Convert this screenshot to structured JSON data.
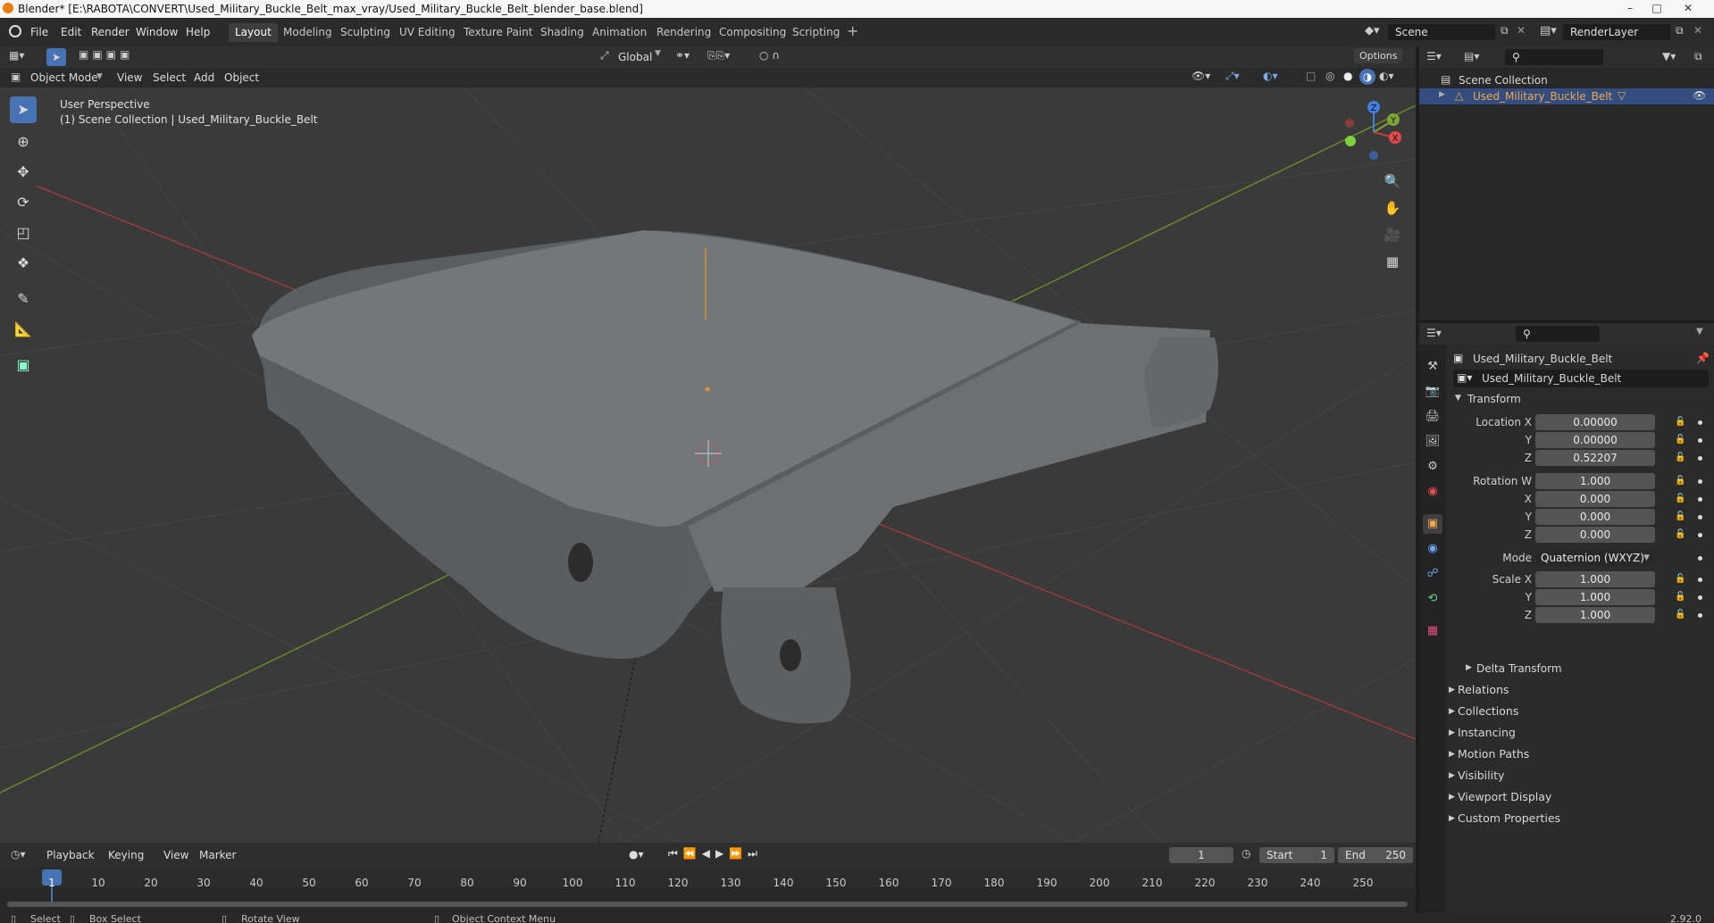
{
  "window": {
    "title": "Blender* [E:\\RABOTA\\CONVERT\\Used_Military_Buckle_Belt_max_vray/Used_Military_Buckle_Belt_blender_base.blend]"
  },
  "menu": [
    "File",
    "Edit",
    "Render",
    "Window",
    "Help"
  ],
  "workspaces": [
    "Layout",
    "Modeling",
    "Sculpting",
    "UV Editing",
    "Texture Paint",
    "Shading",
    "Animation",
    "Rendering",
    "Compositing",
    "Scripting"
  ],
  "active_workspace": "Layout",
  "scene": {
    "name": "Scene",
    "render_layer": "RenderLayer"
  },
  "viewport_header": {
    "mode": "Object Mode",
    "menus": [
      "View",
      "Select",
      "Add",
      "Object"
    ],
    "transform_orientation": "Global",
    "options": "Options"
  },
  "viewport": {
    "perspective": "User Perspective",
    "collection_info": "(1) Scene Collection | Used_Military_Buckle_Belt",
    "gizmo_axes": [
      "Z",
      "Y",
      "X"
    ]
  },
  "outliner": {
    "root": "Scene Collection",
    "items": [
      "Used_Military_Buckle_Belt"
    ]
  },
  "properties": {
    "object_name": "Used_Military_Buckle_Belt",
    "data_name": "Used_Military_Buckle_Belt",
    "transform_title": "Transform",
    "location": {
      "label_x": "Location X",
      "label_y": "Y",
      "label_z": "Z",
      "x": "0.00000",
      "y": "0.00000",
      "z": "0.52207"
    },
    "rotation": {
      "label_w": "Rotation W",
      "label_x": "X",
      "label_y": "Y",
      "label_z": "Z",
      "w": "1.000",
      "x": "0.000",
      "y": "0.000",
      "z": "0.000"
    },
    "mode_label": "Mode",
    "mode_value": "Quaternion (WXYZ)",
    "scale": {
      "label_x": "Scale X",
      "label_y": "Y",
      "label_z": "Z",
      "x": "1.000",
      "y": "1.000",
      "z": "1.000"
    },
    "delta_transform": "Delta Transform",
    "sections": [
      "Relations",
      "Collections",
      "Instancing",
      "Motion Paths",
      "Visibility",
      "Viewport Display",
      "Custom Properties"
    ]
  },
  "timeline": {
    "menus": [
      "Playback",
      "Keying",
      "View",
      "Marker"
    ],
    "current_frame": "1",
    "start_label": "Start",
    "start": "1",
    "end_label": "End",
    "end": "250",
    "ruler": [
      "1",
      "10",
      "20",
      "30",
      "40",
      "50",
      "60",
      "70",
      "80",
      "90",
      "100",
      "110",
      "120",
      "130",
      "140",
      "150",
      "160",
      "170",
      "180",
      "190",
      "200",
      "210",
      "220",
      "230",
      "240",
      "250"
    ]
  },
  "statusbar": {
    "items": [
      "Select",
      "Box Select",
      "Rotate View",
      "Object Context Menu"
    ],
    "version": "2.92.0"
  },
  "colors": {
    "accent": "#4772b3",
    "selected_text": "#f0a848",
    "x_axis": "#c63c3c",
    "y_axis": "#7ea434",
    "z_axis": "#3f7fe0"
  }
}
